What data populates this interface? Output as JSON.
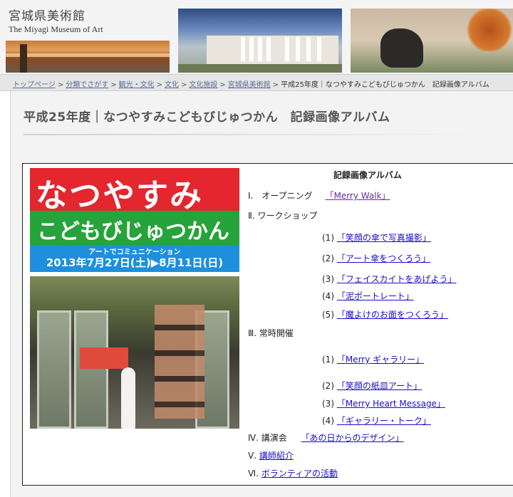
{
  "header": {
    "logo_jp": "宮城県美術館",
    "logo_en": "The Miyagi Museum of Art"
  },
  "breadcrumb": {
    "items": [
      "トップページ",
      "分類でさがす",
      "観光・文化",
      "文化",
      "文化施設",
      "宮城県美術館"
    ],
    "separator": ">",
    "current": "平成25年度｜なつやすみこどもびじゅつかん　記録画像アルバム"
  },
  "page": {
    "title": "平成25年度｜なつやすみこどもびじゅつかん　記録画像アルバム"
  },
  "poster": {
    "line1": "なつやすみ",
    "line2": "こどもびじゅつかん",
    "line3": "アートでコミュニケーション",
    "line4": "2013年7月27日(土)▶8月11日(日)",
    "sign": "なつやすみ こどもびじゅつかん"
  },
  "album": {
    "heading": "記録画像アルバム",
    "sections": [
      {
        "label": "Ⅰ.　オープニング",
        "link": "「Merry Walk」"
      },
      {
        "label": "Ⅱ. ワークショップ",
        "link": ""
      },
      {
        "label": "Ⅲ. 常時開催",
        "link": ""
      },
      {
        "label": "Ⅳ. 講演会",
        "link": "「あの日からのデザイン」"
      },
      {
        "label": "Ⅴ.",
        "link": "講師紹介"
      },
      {
        "label": "Ⅵ.",
        "link": "ボランティアの活動"
      }
    ],
    "workshop_items": [
      {
        "num": "(1)",
        "link": "「笑顔の傘で写真撮影」"
      },
      {
        "num": "(2)",
        "link": "「アート傘をつくろう」"
      },
      {
        "num": "(3)",
        "link": "「フェイスカイトをあげよう」"
      },
      {
        "num": "(4)",
        "link": "「泥ポートレート」"
      },
      {
        "num": "(5)",
        "link": "「魔よけのお面をつくろう」"
      }
    ],
    "regular_items": [
      {
        "num": "(1)",
        "link": "「Merry ギャラリー」"
      },
      {
        "num": "(2)",
        "link": "「笑顔の紙皿アート」"
      },
      {
        "num": "(3)",
        "link": "「Merry Heart Message」"
      },
      {
        "num": "(4)",
        "link": "「ギャラリー・トーク」"
      }
    ]
  },
  "colors": {
    "poster_red": "#e4262e",
    "poster_green": "#26a33b",
    "poster_blue": "#1e8fdc",
    "link": "#1a0dcc",
    "visited_link": "#6b2aa0"
  }
}
